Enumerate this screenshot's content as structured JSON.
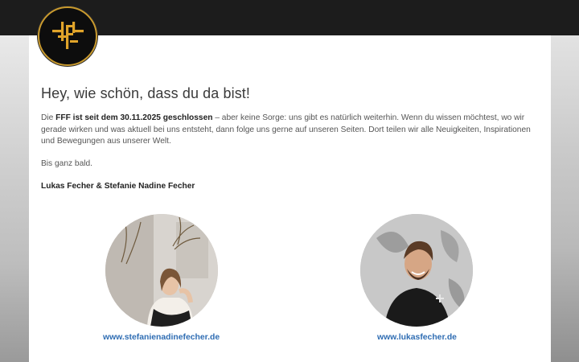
{
  "header": {
    "logo_icon": "fff-monogram-icon",
    "logo_color": "#e0a42a"
  },
  "main": {
    "heading": "Hey, wie schön, dass du da bist!",
    "intro_prefix": "Die ",
    "intro_bold": "FFF ist seit dem 30.11.2025 geschlossen",
    "intro_rest": " – aber keine Sorge: uns gibt es natürlich weiterhin. Wenn du wissen möchtest, wo wir gerade wirken und was aktuell bei uns entsteht, dann folge uns gerne auf unseren Seiten. Dort teilen wir alle Neuigkeiten, Inspirationen und Bewegungen aus unserer Welt.",
    "farewell": "Bis ganz bald.",
    "signature": "Lukas Fecher & Stefanie Nadine Fecher"
  },
  "profiles": [
    {
      "link": "www.stefanienadinefecher.de"
    },
    {
      "link": "www.lukasfecher.de"
    }
  ],
  "colors": {
    "topbar": "#1c1c1c",
    "link": "#2f6db3",
    "accent_gold": "#e0a42a"
  }
}
